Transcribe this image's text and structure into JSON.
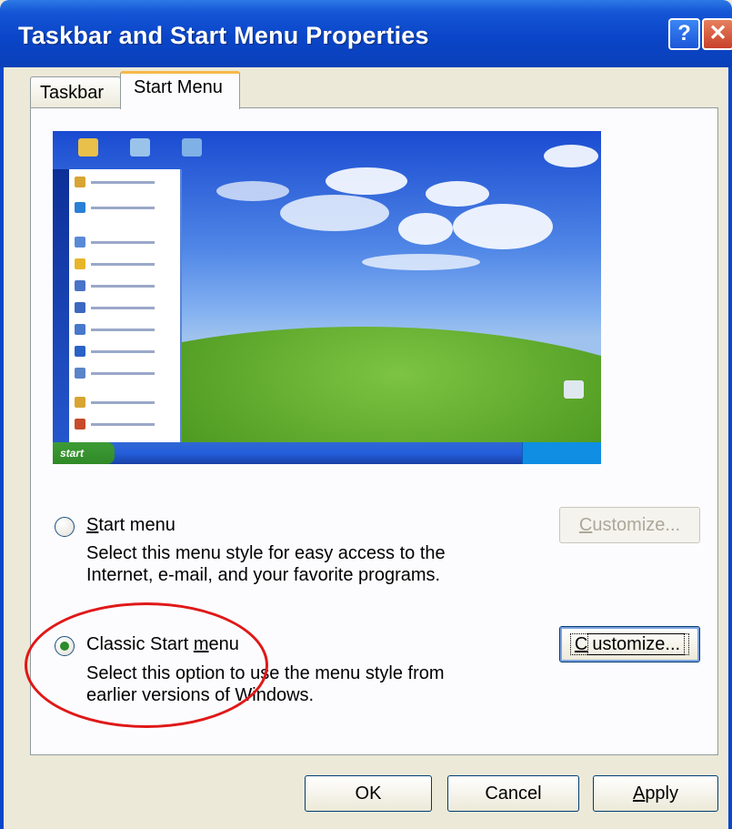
{
  "window": {
    "title": "Taskbar and Start Menu Properties",
    "help_glyph": "?",
    "close_glyph": "✕"
  },
  "tabs": [
    {
      "label": "Taskbar"
    },
    {
      "label": "Start Menu"
    }
  ],
  "preview": {
    "start_button": "start"
  },
  "options": {
    "start_menu": {
      "label_underlined": "S",
      "label_rest": "tart menu",
      "description_line1": "Select this menu style for easy access to the",
      "description_line2": "Internet, e-mail, and your favorite programs.",
      "customize_underlined": "C",
      "customize_rest": "ustomize...",
      "selected": false,
      "customize_enabled": false
    },
    "classic_start_menu": {
      "label_before": "Classic Start ",
      "label_underlined": "m",
      "label_after": "enu",
      "description_line1": "Select this option to use the menu style from",
      "description_line2": "earlier versions of Windows.",
      "customize_underlined": "C",
      "customize_rest": "ustomize...",
      "selected": true,
      "customize_enabled": true
    }
  },
  "footer": {
    "ok": "OK",
    "cancel": "Cancel",
    "apply_underlined": "A",
    "apply_rest": "pply"
  },
  "colors": {
    "titlebar": "#0a46c9",
    "annotation_ring": "#e01818",
    "radio_selected": "#2b8a2b"
  }
}
